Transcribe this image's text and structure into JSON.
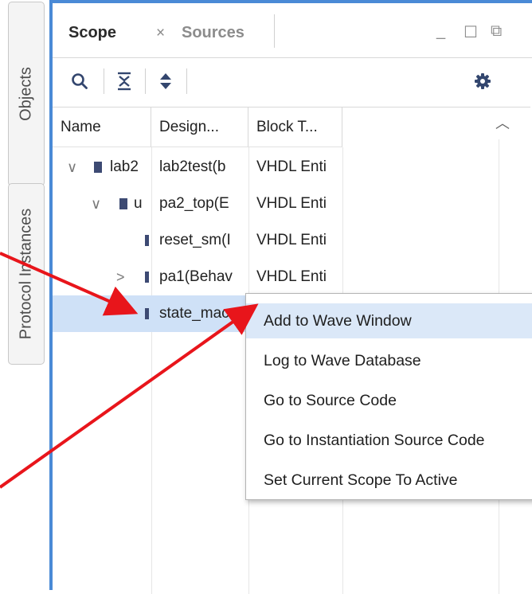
{
  "side_tabs": {
    "objects": "Objects",
    "protocol": "Protocol Instances"
  },
  "tabs": {
    "scope": "Scope",
    "sources": "Sources",
    "close_glyph": "×"
  },
  "window_controls": {
    "minimize": "_",
    "maximize": "☐",
    "restore": "⧉"
  },
  "toolbar": {
    "icons": [
      "search-icon",
      "collapse-all-icon",
      "expand-all-icon",
      "gear-icon"
    ]
  },
  "columns": [
    "Name",
    "Design...",
    "Block T..."
  ],
  "rows": [
    {
      "name": "lab2",
      "design": "lab2test(b",
      "block": "VHDL Enti",
      "chevron": "∨"
    },
    {
      "name": "u",
      "design": "pa2_top(E",
      "block": "VHDL Enti",
      "chevron": "∨"
    },
    {
      "name": "",
      "design": "reset_sm(I",
      "block": "VHDL Enti",
      "chevron": ""
    },
    {
      "name": "",
      "design": "pa1(Behav",
      "block": "VHDL Enti",
      "chevron": ">"
    },
    {
      "name": "",
      "design": "state_mac",
      "block": "",
      "chevron": ""
    }
  ],
  "context_menu": {
    "items": [
      "Add to Wave Window",
      "Log to Wave Database",
      "Go to Source Code",
      "Go to Instantiation Source Code",
      "Set Current Scope To Active"
    ]
  },
  "colors": {
    "accent": "#4a8ad6",
    "selection": "#cfe1f7",
    "annotation_arrow": "#e8151b",
    "chip": "#3d4a73"
  }
}
